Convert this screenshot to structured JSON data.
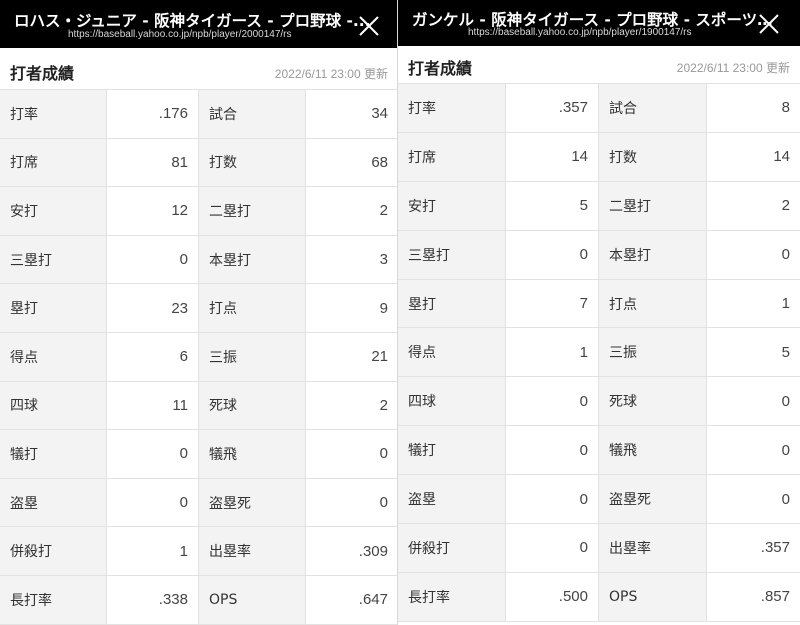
{
  "left": {
    "window_title": "ロハス・ジュニア - 阪神タイガース - プロ野球 -...",
    "url": "https://baseball.yahoo.co.jp/npb/player/2000147/rs",
    "section_title": "打者成績",
    "updated": "2022/6/11 23:00 更新",
    "rows": [
      {
        "l1": "打率",
        "v1": ".176",
        "l2": "試合",
        "v2": "34"
      },
      {
        "l1": "打席",
        "v1": "81",
        "l2": "打数",
        "v2": "68"
      },
      {
        "l1": "安打",
        "v1": "12",
        "l2": "二塁打",
        "v2": "2"
      },
      {
        "l1": "三塁打",
        "v1": "0",
        "l2": "本塁打",
        "v2": "3"
      },
      {
        "l1": "塁打",
        "v1": "23",
        "l2": "打点",
        "v2": "9"
      },
      {
        "l1": "得点",
        "v1": "6",
        "l2": "三振",
        "v2": "21"
      },
      {
        "l1": "四球",
        "v1": "11",
        "l2": "死球",
        "v2": "2"
      },
      {
        "l1": "犠打",
        "v1": "0",
        "l2": "犠飛",
        "v2": "0"
      },
      {
        "l1": "盗塁",
        "v1": "0",
        "l2": "盗塁死",
        "v2": "0"
      },
      {
        "l1": "併殺打",
        "v1": "1",
        "l2": "出塁率",
        "v2": ".309"
      },
      {
        "l1": "長打率",
        "v1": ".338",
        "l2": "OPS",
        "v2": ".647"
      }
    ]
  },
  "right": {
    "window_title": "ガンケル - 阪神タイガース - プロ野球 - スポーツ…",
    "url": "https://baseball.yahoo.co.jp/npb/player/1900147/rs",
    "section_title": "打者成績",
    "updated": "2022/6/11 23:00 更新",
    "rows": [
      {
        "l1": "打率",
        "v1": ".357",
        "l2": "試合",
        "v2": "8"
      },
      {
        "l1": "打席",
        "v1": "14",
        "l2": "打数",
        "v2": "14"
      },
      {
        "l1": "安打",
        "v1": "5",
        "l2": "二塁打",
        "v2": "2"
      },
      {
        "l1": "三塁打",
        "v1": "0",
        "l2": "本塁打",
        "v2": "0"
      },
      {
        "l1": "塁打",
        "v1": "7",
        "l2": "打点",
        "v2": "1"
      },
      {
        "l1": "得点",
        "v1": "1",
        "l2": "三振",
        "v2": "5"
      },
      {
        "l1": "四球",
        "v1": "0",
        "l2": "死球",
        "v2": "0"
      },
      {
        "l1": "犠打",
        "v1": "0",
        "l2": "犠飛",
        "v2": "0"
      },
      {
        "l1": "盗塁",
        "v1": "0",
        "l2": "盗塁死",
        "v2": "0"
      },
      {
        "l1": "併殺打",
        "v1": "0",
        "l2": "出塁率",
        "v2": ".357"
      },
      {
        "l1": "長打率",
        "v1": ".500",
        "l2": "OPS",
        "v2": ".857"
      }
    ]
  },
  "colors": {
    "topbar_bg": "#000000",
    "label_bg": "#f3f3f3",
    "value_bg": "#ffffff",
    "border": "#e2e2e2"
  },
  "icons": {
    "close": "close-icon"
  }
}
